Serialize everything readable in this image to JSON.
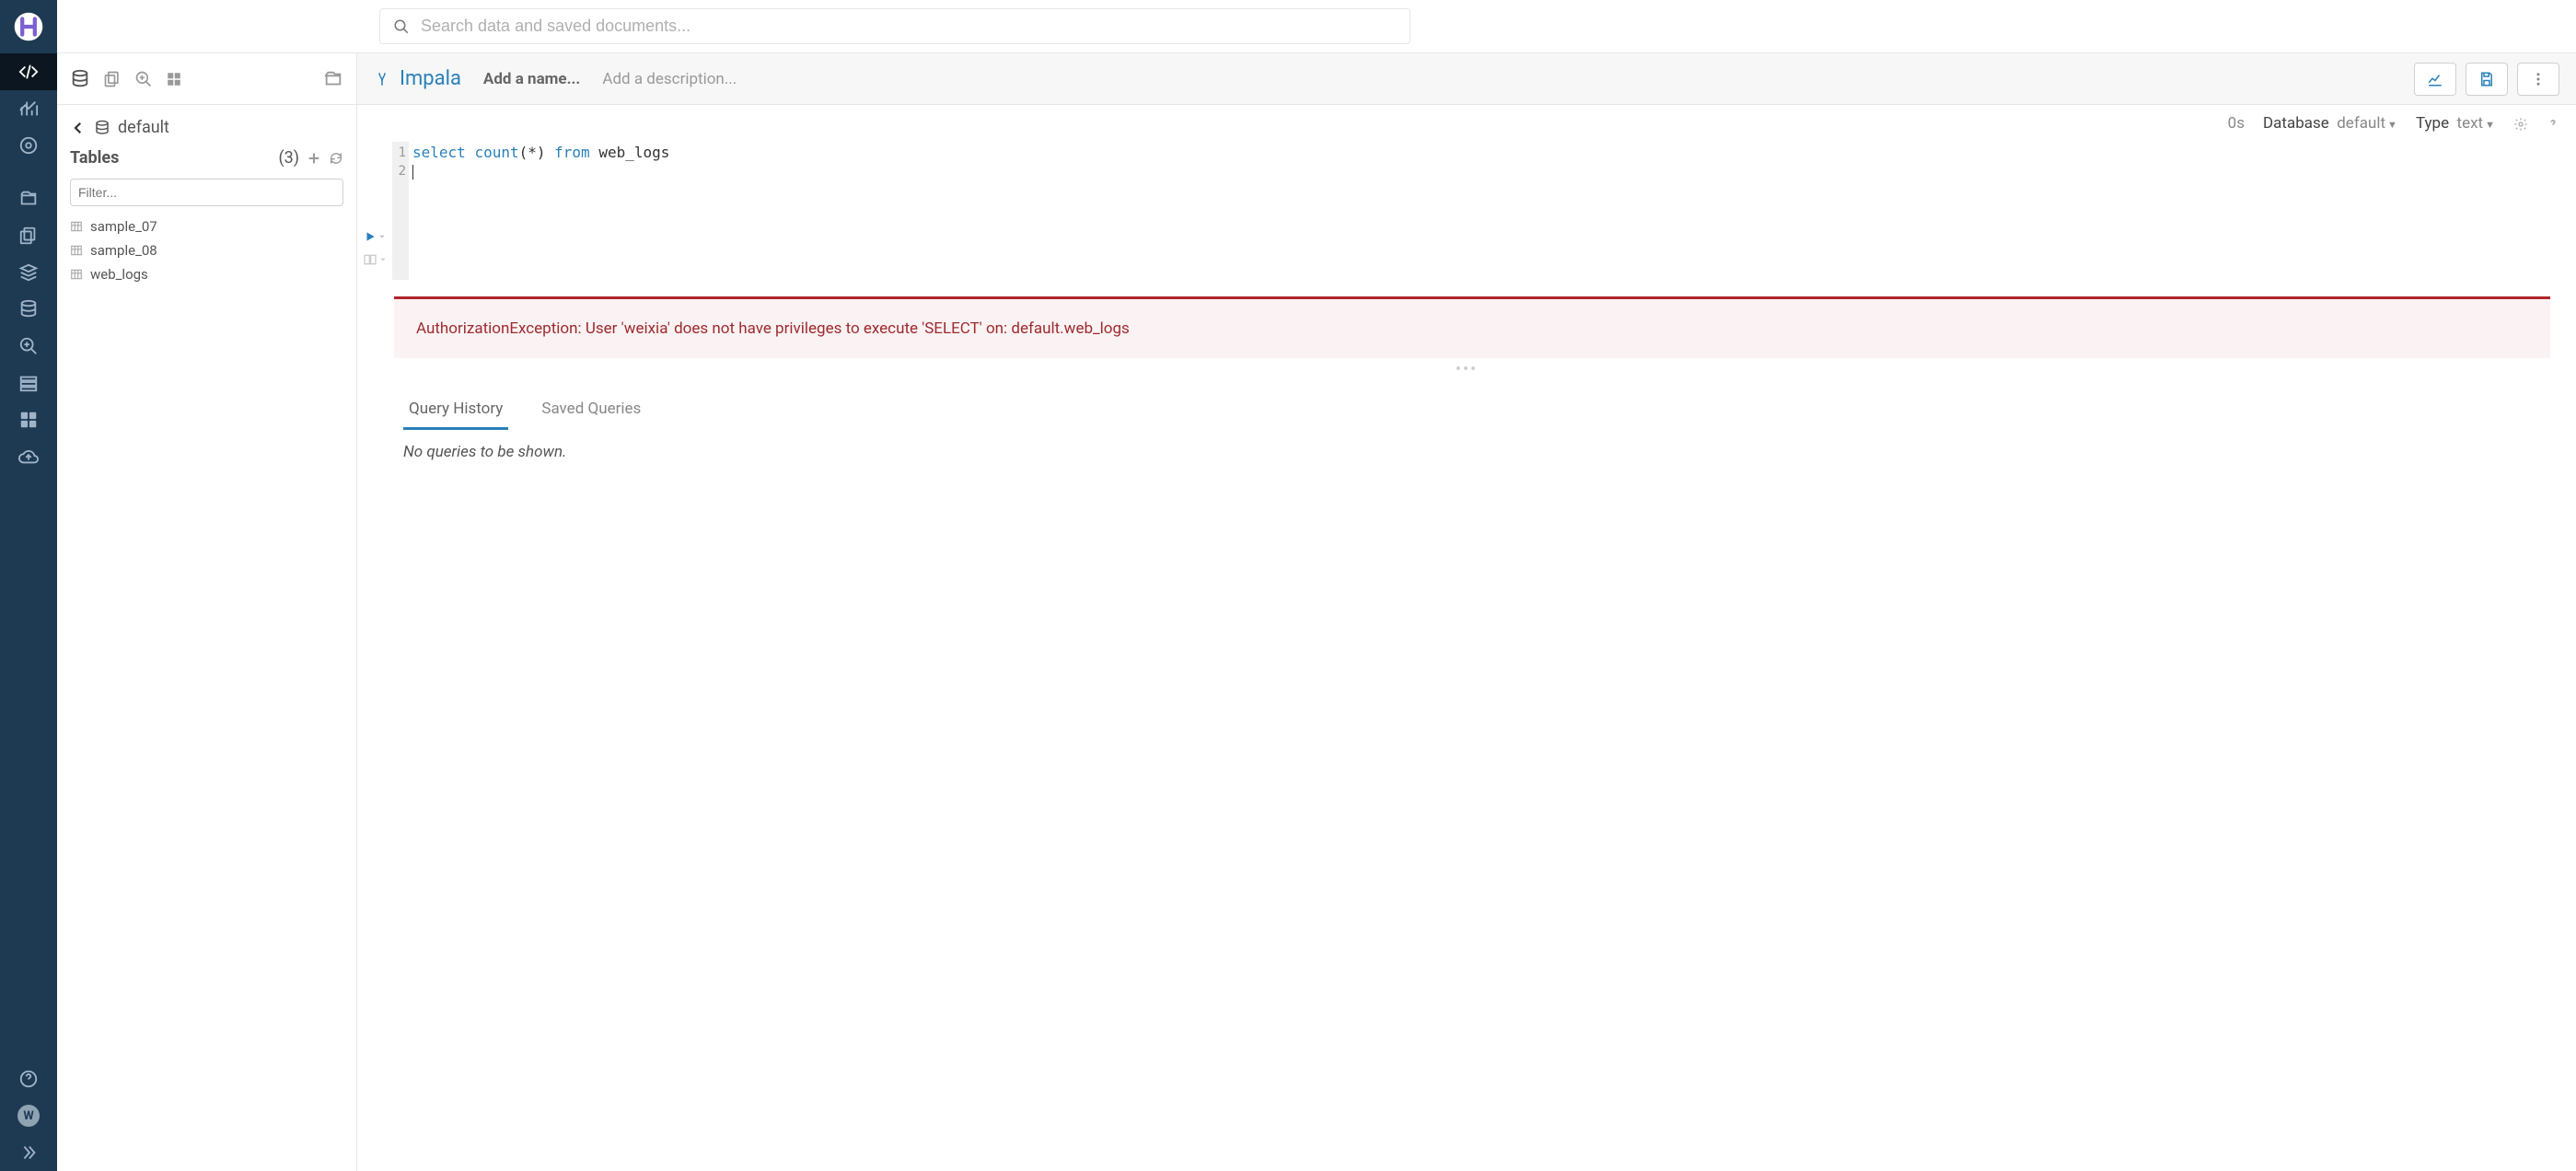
{
  "topbar": {
    "search_placeholder": "Search data and saved documents..."
  },
  "rail": {
    "avatar_letter": "W"
  },
  "leftpanel": {
    "database_label": "default",
    "tables_label": "Tables",
    "tables_count": "(3)",
    "filter_placeholder": "Filter...",
    "tables": [
      {
        "name": "sample_07"
      },
      {
        "name": "sample_08"
      },
      {
        "name": "web_logs"
      }
    ]
  },
  "editor": {
    "engine": "Impala",
    "name_placeholder": "Add a name...",
    "desc_placeholder": "Add a description...",
    "meta": {
      "duration": "0s",
      "database_label": "Database",
      "database_value": "default",
      "type_label": "Type",
      "type_value": "text"
    },
    "code": {
      "line_numbers": [
        "1",
        "2"
      ],
      "line1_kw1": "select",
      "line1_fn": "count",
      "line1_paren": "(*)",
      "line1_kw2": "from",
      "line1_tbl": "web_logs"
    },
    "error": "AuthorizationException: User 'weixia' does not have privileges to execute 'SELECT' on: default.web_logs",
    "tabs": {
      "history": "Query History",
      "saved": "Saved Queries"
    },
    "empty_msg": "No queries to be shown."
  }
}
